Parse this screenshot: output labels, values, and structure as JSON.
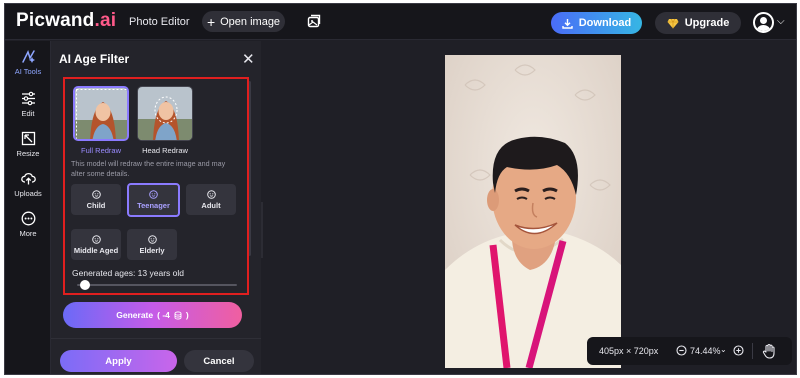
{
  "header": {
    "logo_main": "Picwand",
    "logo_suffix": ".ai",
    "nav_title": "Photo Editor",
    "open_image_label": "Open image",
    "download_label": "Download",
    "upgrade_label": "Upgrade"
  },
  "rail": {
    "items": [
      {
        "label": "AI Tools",
        "icon": "ai-tools-icon"
      },
      {
        "label": "Edit",
        "icon": "sliders-icon"
      },
      {
        "label": "Resize",
        "icon": "resize-icon"
      },
      {
        "label": "Uploads",
        "icon": "upload-cloud-icon"
      },
      {
        "label": "More",
        "icon": "more-icon"
      }
    ]
  },
  "panel": {
    "title": "AI Age Filter",
    "modes": [
      {
        "label": "Full Redraw",
        "selected": true
      },
      {
        "label": "Head Redraw",
        "selected": false
      }
    ],
    "description": "This model will redraw the entire image and may alter some details.",
    "ages": [
      {
        "label": "Child",
        "selected": false
      },
      {
        "label": "Teenager",
        "selected": true
      },
      {
        "label": "Adult",
        "selected": false
      },
      {
        "label": "Middle Aged",
        "selected": false
      },
      {
        "label": "Elderly",
        "selected": false
      }
    ],
    "generated_ages_label": "Generated ages: 13 years old",
    "age_slider_level": 0.05,
    "generate_label": "Generate",
    "generate_cost": "( -4",
    "generate_cost_close": ")",
    "apply_label": "Apply",
    "cancel_label": "Cancel"
  },
  "canvas": {
    "dimensions_label": "405px × 720px",
    "zoom_label": "74.44%"
  },
  "colors": {
    "accent_purple": "#8b7bff",
    "download_gradient_start": "#4a6cf7",
    "download_gradient_end": "#36b6e4",
    "logo_accent": "#ff5a8a",
    "highlight_box": "#e01f1f"
  }
}
